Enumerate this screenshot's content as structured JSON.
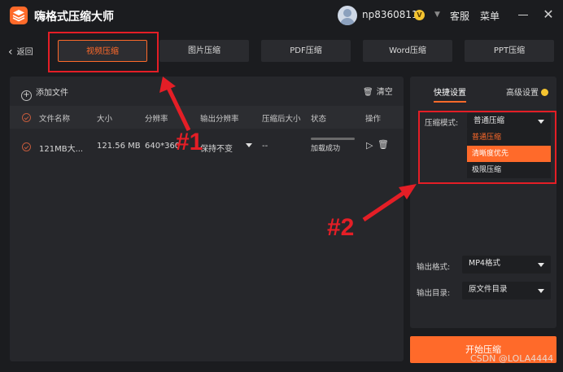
{
  "title_bar": {
    "app_title": "嗨格式压缩大师",
    "username": "np8360811",
    "vip_badge": "V",
    "service_label": "客服",
    "menu_label": "菜单",
    "close_glyph": "✕"
  },
  "nav": {
    "back_label": "返回",
    "tabs": [
      {
        "label": "视频压缩",
        "active": true
      },
      {
        "label": "图片压缩",
        "active": false
      },
      {
        "label": "PDF压缩",
        "active": false
      },
      {
        "label": "Word压缩",
        "active": false
      },
      {
        "label": "PPT压缩",
        "active": false
      }
    ]
  },
  "file_panel": {
    "add_file_label": "添加文件",
    "clear_label": "清空",
    "columns": [
      "文件名称",
      "大小",
      "分辨率",
      "输出分辨率",
      "压缩后大小",
      "状态",
      "操作"
    ],
    "rows": [
      {
        "name": "121MB大...",
        "size": "121.56 MB",
        "resolution": "640*360",
        "output_resolution": "保持不变",
        "compressed_size": "--",
        "status": "加载成功",
        "progress": 1.0
      }
    ]
  },
  "settings_panel": {
    "tabs": [
      {
        "label": "快捷设置",
        "active": true
      },
      {
        "label": "高级设置",
        "active": false
      }
    ],
    "compress_mode_label": "压缩模式:",
    "compress_mode_value": "普通压缩",
    "compress_mode_options": [
      "普通压缩",
      "清晰度优先",
      "极限压缩"
    ],
    "highlighted_option_index": 1,
    "output_format_label": "输出格式:",
    "output_format_value": "MP4格式",
    "output_dir_label": "输出目录:",
    "output_dir_value": "原文件目录"
  },
  "start_button_label": "开始压缩",
  "watermark": "CSDN @LOLA4444",
  "annotations": {
    "label_1": "#1",
    "label_2": "#2",
    "color": "#e41e26"
  },
  "colors": {
    "accent": "#ff6a2a",
    "background": "#1b1c1f",
    "panel": "#26272b"
  }
}
